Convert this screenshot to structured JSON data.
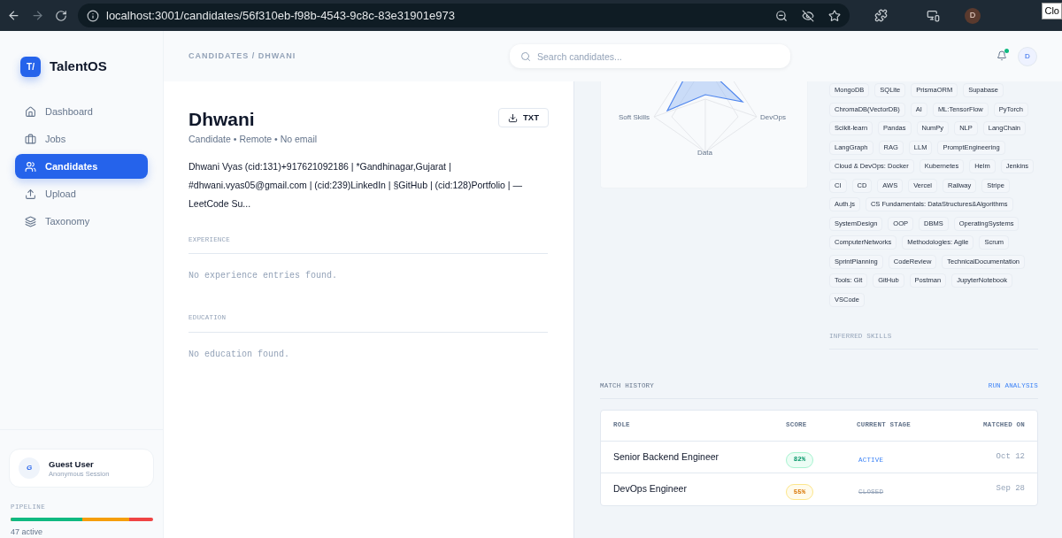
{
  "browser": {
    "url": "localhost:3001/candidates/56f310eb-f98b-4543-9c8c-83e31901e973",
    "forward_disabled": true,
    "profile_initial": "D",
    "tooltip": "Clo"
  },
  "sidebar": {
    "logo_mark": "T/",
    "brand": "TalentOS",
    "items": [
      {
        "label": "Dashboard",
        "selected": false
      },
      {
        "label": "Jobs",
        "selected": false
      },
      {
        "label": "Candidates",
        "selected": true
      },
      {
        "label": "Upload",
        "selected": false
      },
      {
        "label": "Taxonomy",
        "selected": false
      }
    ],
    "user": {
      "initial": "G",
      "name": "Guest User",
      "session": "Anonymous Session"
    },
    "pipeline": {
      "label": "PIPELINE",
      "color": "#ef4444",
      "fills": [
        {
          "color": "#f59e0b",
          "level": 0.83
        },
        {
          "color": "#10b981",
          "level": 0.5
        }
      ],
      "count": "47 active"
    }
  },
  "header": {
    "breadcrumb": "CANDIDATES / DHWANI",
    "search": {
      "placeholder": "Search candidates..."
    },
    "has_unread": true,
    "avatar": "D"
  },
  "profile": {
    "name": "Dhwani",
    "meta": "Candidate • Remote • No email",
    "export_button": "TXT",
    "summary": "Dhwani Vyas (cid:131)+917621092186 | *Gandhinagar,Gujarat | #dhwani.vyas05@gmail.com | (cid:239)LinkedIn | §GitHub | (cid:128)Portfolio | — LeetCode Su...",
    "sections": [
      {
        "title": "EXPERIENCE",
        "empty": "No experience entries found."
      },
      {
        "title": "EDUCATION",
        "empty": "No education found."
      }
    ]
  },
  "radar": {
    "labels": [
      "Soft Skills",
      "DevOps",
      "Data"
    ]
  },
  "skills": [
    "MongoDB",
    "SQLite",
    "PrismaORM",
    "Supabase",
    "ChromaDB(VectorDB)",
    "AI",
    "ML:TensorFlow",
    "PyTorch",
    "Scikit-learn",
    "Pandas",
    "NumPy",
    "NLP",
    "LangChain",
    "LangGraph",
    "RAG",
    "LLM",
    "PromptEngineering",
    "Cloud & DevOps: Docker",
    "Kubernetes",
    "Helm",
    "Jenkins",
    "CI",
    "CD",
    "AWS",
    "Vercel",
    "Railway",
    "Stripe",
    "Auth.js",
    "CS Fundamentals: DataStructures&Algorithms",
    "SystemDesign",
    "OOP",
    "DBMS",
    "OperatingSystems",
    "ComputerNetworks",
    "Methodologies: Agile",
    "Scrum",
    "SprintPlanning",
    "CodeReview",
    "TechnicalDocumentation",
    "Tools: Git",
    "GitHub",
    "Postman",
    "JupyterNotebook",
    "VSCode"
  ],
  "inferred_title": "INFERRED SKILLS",
  "match_history": {
    "title": "MATCH HISTORY",
    "action": "RUN ANALYSIS",
    "columns": [
      "ROLE",
      "SCORE",
      "CURRENT STAGE",
      "MATCHED ON"
    ],
    "rows": [
      {
        "role": "Senior Backend Engineer",
        "score": "82%",
        "kind": "high",
        "stage": "ACTIVE",
        "closed": false,
        "date": "Oct 12"
      },
      {
        "role": "DevOps Engineer",
        "score": "55%",
        "kind": "medium",
        "stage": "CLOSED",
        "closed": true,
        "date": "Sep 28"
      }
    ]
  }
}
